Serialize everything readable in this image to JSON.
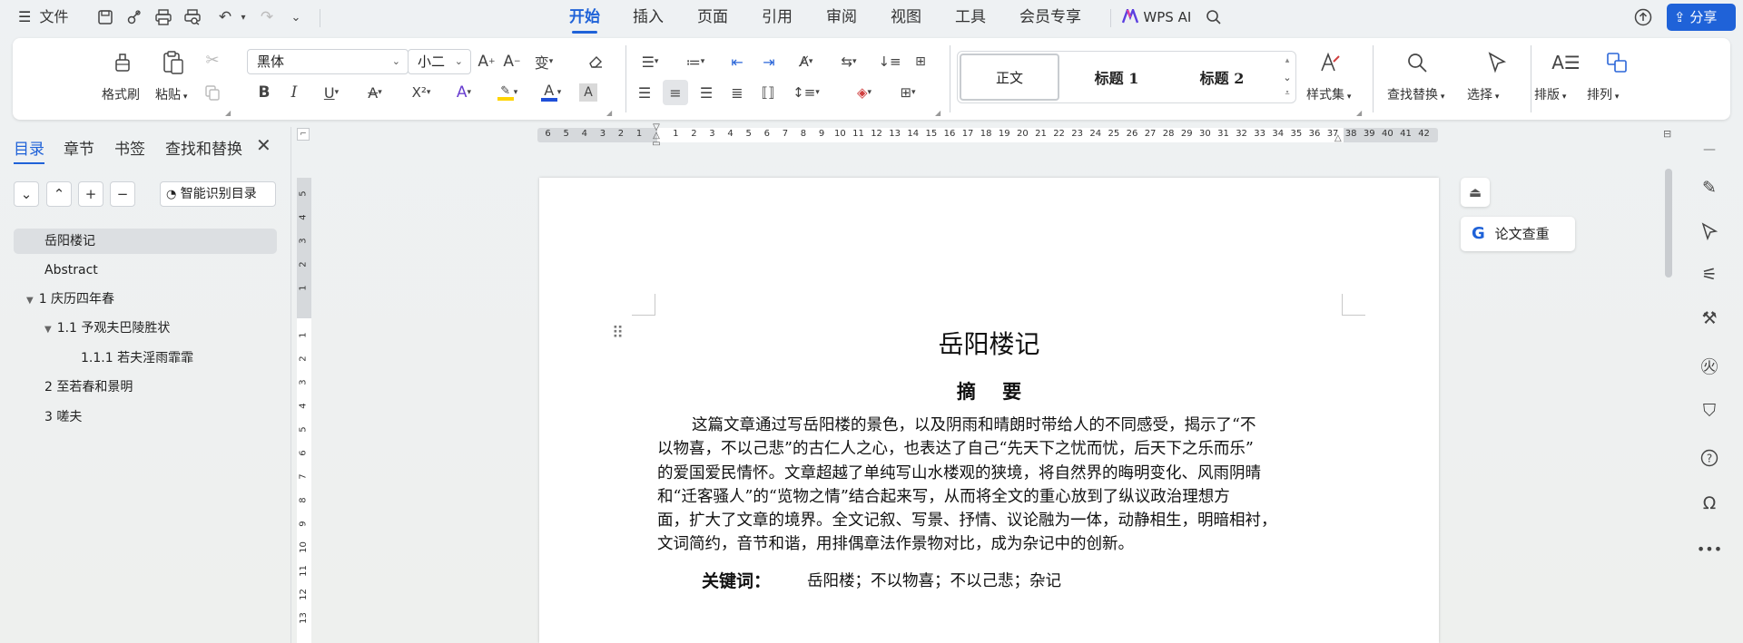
{
  "topbar": {
    "file_label": "文件",
    "menu_tabs": [
      "开始",
      "插入",
      "页面",
      "引用",
      "审阅",
      "视图",
      "工具",
      "会员专享"
    ],
    "active_tab": "开始",
    "wps_ai": "WPS AI",
    "share": "分享"
  },
  "ribbon": {
    "format_painter": "格式刷",
    "paste": "粘贴",
    "font_name": "黑体",
    "font_size": "小二",
    "styles": [
      "正文",
      "标题 1",
      "标题 2"
    ],
    "style_set": "样式集",
    "find_replace": "查找替换",
    "select": "选择",
    "layout": "排版",
    "arrange": "排列",
    "bold": "B",
    "italic": "I",
    "underline": "U",
    "strike": "A",
    "superscript": "X²",
    "font_effect": "A",
    "font_color": "A",
    "char_shade": "A"
  },
  "colors": {
    "accent": "#1f62d8",
    "highlight": "#ffd400",
    "font_color": "#1f4fd8"
  },
  "left_panel": {
    "tabs": [
      "目录",
      "章节",
      "书签",
      "查找和替换"
    ],
    "smart_toc": "智能识别目录",
    "toc": [
      {
        "label": "岳阳楼记",
        "level": 0,
        "selected": true
      },
      {
        "label": "Abstract",
        "level": 0
      },
      {
        "label": "1 庆历四年春",
        "level": 0,
        "expanded": true
      },
      {
        "label": "1.1 予观夫巴陵胜状",
        "level": 1,
        "expanded": true
      },
      {
        "label": "1.1.1 若夫淫雨霏霏",
        "level": 2
      },
      {
        "label": "2 至若春和景明",
        "level": 0
      },
      {
        "label": "3 嗟夫",
        "level": 0
      }
    ]
  },
  "rulers": {
    "h_left": [
      "6",
      "5",
      "4",
      "3",
      "2",
      "1"
    ],
    "h_main": [
      "1",
      "2",
      "3",
      "4",
      "5",
      "6",
      "7",
      "8",
      "9",
      "10",
      "11",
      "12",
      "13",
      "14",
      "15",
      "16",
      "17",
      "18",
      "19",
      "20",
      "21",
      "22",
      "23",
      "24",
      "25",
      "26",
      "27",
      "28",
      "29",
      "30",
      "31",
      "32",
      "33",
      "34",
      "35",
      "36",
      "37",
      "38",
      "39",
      "40",
      "41",
      "42"
    ],
    "v_top": [
      "5",
      "4",
      "3",
      "2",
      "1"
    ],
    "v_main": [
      "1",
      "2",
      "3",
      "4",
      "5",
      "6",
      "7",
      "8",
      "9",
      "10",
      "11",
      "12",
      "13"
    ]
  },
  "document": {
    "title": "岳阳楼记",
    "abstract_heading": "摘    要",
    "abstract_lines": [
      "这篇文章通过写岳阳楼的景色，以及阴雨和晴朗时带给人的不同感受，揭示了“不",
      "以物喜，不以己悲”的古仁人之心，也表达了自己“先天下之忧而忧，后天下之乐而乐”",
      "的爱国爱民情怀。文章超越了单纯写山水楼观的狭境，将自然界的晦明变化、风雨阴晴",
      "和“迁客骚人”的“览物之情”结合起来写，从而将全文的重心放到了纵议政治理想方",
      "面，扩大了文章的境界。全文记叙、写景、抒情、议论融为一体，动静相生，明暗相衬，",
      "文词简约，音节和谐，用排偶章法作景物对比，成为杂记中的创新。"
    ],
    "keywords_label": "关键词：",
    "keywords": "岳阳楼；不以物喜；不以己悲；杂记"
  },
  "side_buttons": {
    "paper_check": "论文查重"
  }
}
